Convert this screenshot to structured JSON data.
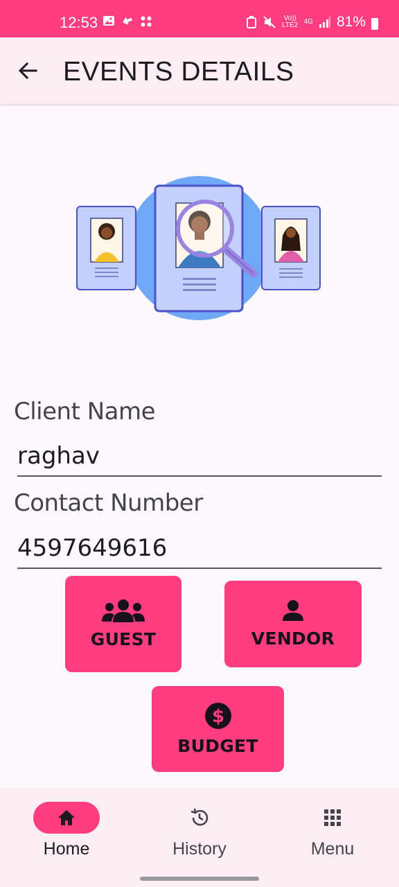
{
  "status_bar": {
    "time": "12:53",
    "battery": "81%",
    "network": "4G",
    "volte": "Vo)) LTE2"
  },
  "app_bar": {
    "title": "EVENTS DETAILS",
    "back_icon": "arrow-back-icon"
  },
  "form": {
    "client_name_label": "Client Name",
    "client_name_value": "raghav",
    "contact_label": "Contact Number",
    "contact_value": "4597649616"
  },
  "actions": {
    "guest_label": "GUEST",
    "guest_icon": "group-icon",
    "vendor_label": "VENDOR",
    "vendor_icon": "person-icon",
    "budget_label": "BUDGET",
    "budget_icon": "dollar-circle-icon"
  },
  "bottom_nav": {
    "items": [
      {
        "label": "Home",
        "icon": "home-icon",
        "active": true
      },
      {
        "label": "History",
        "icon": "history-icon",
        "active": false
      },
      {
        "label": "Menu",
        "icon": "grid-menu-icon",
        "active": false
      }
    ]
  },
  "colors": {
    "accent": "#ff3d7f",
    "app_bar_bg": "#fdeef3",
    "page_bg": "#fdf8fb"
  }
}
